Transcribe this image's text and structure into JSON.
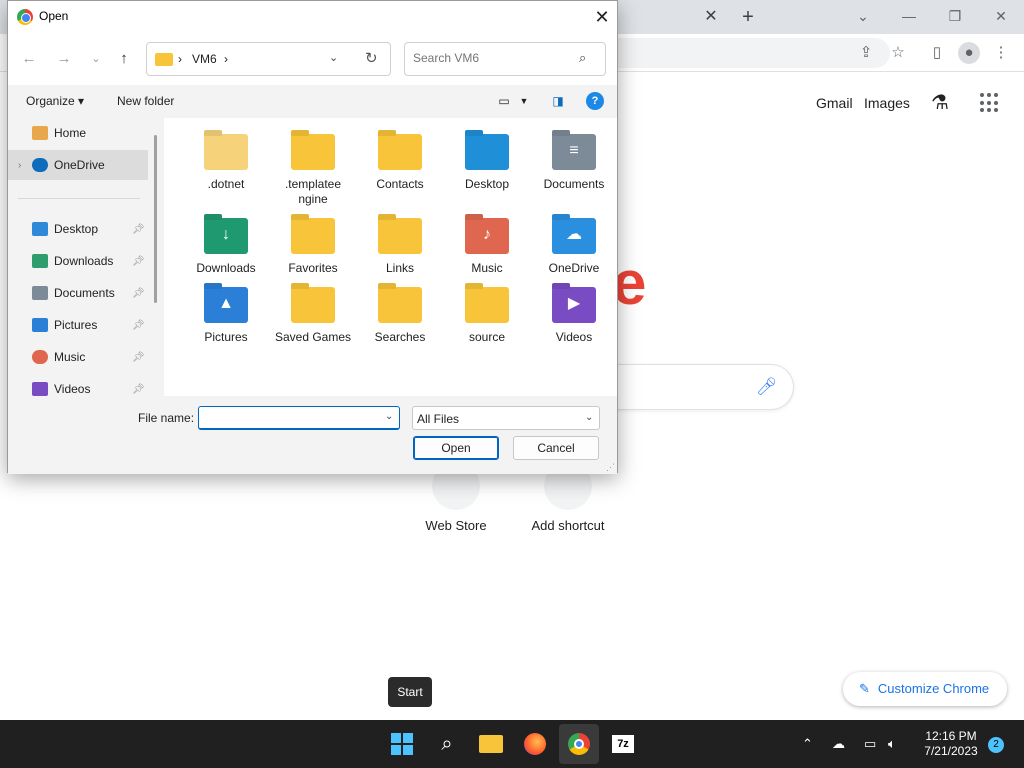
{
  "browser": {
    "links": [
      "Gmail",
      "Images"
    ],
    "shortcuts": [
      "Web Store",
      "Add shortcut"
    ],
    "customize_label": "Customize Chrome",
    "tooltip": "Start",
    "logo_fragment": "e"
  },
  "dialog": {
    "title": "Open",
    "breadcrumb": [
      "VM6"
    ],
    "search_placeholder": "Search VM6",
    "organize_label": "Organize ▾",
    "new_folder_label": "New folder",
    "sidebar": [
      {
        "label": "Home",
        "icon": "home-icon",
        "color": "#e8a74a"
      },
      {
        "label": "OneDrive",
        "icon": "cloud-icon",
        "color": "#0f6cbd",
        "selected": true
      },
      {
        "label": "Desktop",
        "icon": "desktop-icon",
        "color": "#2e8ad8"
      },
      {
        "label": "Downloads",
        "icon": "download-icon",
        "color": "#2e9e6e"
      },
      {
        "label": "Documents",
        "icon": "document-icon",
        "color": "#7d8a98"
      },
      {
        "label": "Pictures",
        "icon": "pictures-icon",
        "color": "#2b7fd6"
      },
      {
        "label": "Music",
        "icon": "music-icon",
        "color": "#e0674f"
      },
      {
        "label": "Videos",
        "icon": "videos-icon",
        "color": "#7a4cc4"
      }
    ],
    "files": [
      {
        "label": ".dotnet",
        "color": "#f6d27a"
      },
      {
        "label": ".templatee ngine",
        "color": "#f8c53a"
      },
      {
        "label": "Contacts",
        "color": "#f8c53a"
      },
      {
        "label": "Desktop",
        "color": "#1f8fd8"
      },
      {
        "label": "Documents",
        "color": "#7d8a98"
      },
      {
        "label": "Downloads",
        "color": "#1f9a70"
      },
      {
        "label": "Favorites",
        "color": "#f8c53a"
      },
      {
        "label": "Links",
        "color": "#f8c53a"
      },
      {
        "label": "Music",
        "color": "#e0674f"
      },
      {
        "label": "OneDrive",
        "color": "#2b8fe0"
      },
      {
        "label": "Pictures",
        "color": "#2b7fd6"
      },
      {
        "label": "Saved Games",
        "color": "#f8c53a"
      },
      {
        "label": "Searches",
        "color": "#f8c53a"
      },
      {
        "label": "source",
        "color": "#f8c53a"
      },
      {
        "label": "Videos",
        "color": "#7a4cc4"
      }
    ],
    "file_name_label": "File name:",
    "file_name_value": "",
    "filter_value": "All Files",
    "open_label": "Open",
    "cancel_label": "Cancel"
  },
  "taskbar": {
    "time": "12:16 PM",
    "date": "7/21/2023",
    "notification_count": "2"
  }
}
